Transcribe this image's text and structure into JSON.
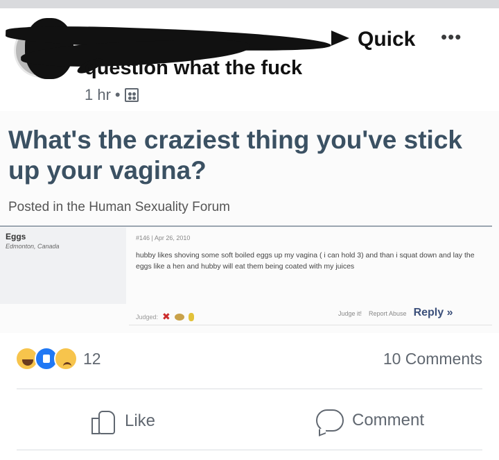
{
  "post": {
    "group_name_part1": "Quick",
    "group_name_part2": "question what the fuck",
    "time": "1 hr",
    "separator": "•",
    "privacy_icon": "group-icon",
    "more_icon": "•••"
  },
  "embedded": {
    "question_title": "What's the craziest thing you've stick up your vagina?",
    "posted_in": "Posted in the Human Sexuality Forum",
    "username": "Eggs",
    "location": "Edmonton, Canada",
    "post_meta": "#146 | Apr 26, 2010",
    "post_body": "hubby likes shoving some soft boiled eggs up my vagina ( i can hold 3) and than i squat down and lay the eggs like a hen and hubby will eat them being coated with my juices",
    "judged_label": "Judged:",
    "judge_it": "Judge it!",
    "report_abuse": "Report Abuse",
    "reply": "Reply »"
  },
  "stats": {
    "reactions": [
      "haha",
      "like",
      "sad"
    ],
    "reaction_count": "12",
    "comments": "10 Comments"
  },
  "actions": {
    "like": "Like",
    "comment": "Comment"
  }
}
